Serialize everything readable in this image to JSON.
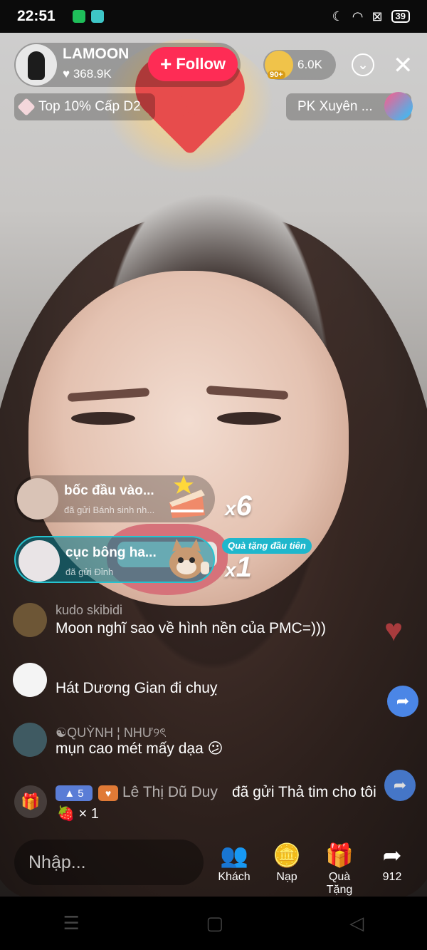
{
  "status_bar": {
    "time": "22:51",
    "battery": "39",
    "icons": [
      "moon-icon",
      "wifi-icon",
      "sim-icon",
      "battery-icon"
    ]
  },
  "host": {
    "name": "LAMOON",
    "likes": "368.9K",
    "follow_label": "Follow"
  },
  "viewers": {
    "badge": "90+",
    "count": "6.0K"
  },
  "rank": {
    "label": "Top 10% Cấp D2"
  },
  "pk": {
    "label": "PK Xuyên ..."
  },
  "gifts": [
    {
      "user": "bốc đầu vào...",
      "subtitle": "đã gửi Bánh sinh nh...",
      "combo_x": "x",
      "combo_n": "6"
    },
    {
      "user": "cục bông ha...",
      "subtitle": "đã gửi Đỉnh",
      "combo_x": "x",
      "combo_n": "1",
      "tag": "Quà tặng đầu tiên"
    }
  ],
  "comments": [
    {
      "user": "kudo skibidi",
      "text": "Moon nghĩ sao về hình nền của PMC=)))"
    },
    {
      "user": "",
      "text": "Hát Dương Gian đi chuỵ"
    },
    {
      "user": "☯QUỲNH ¦ NHƯ୨ৎ",
      "text": "mụn cao mét mấy dạa 😕"
    }
  ],
  "gift_event": {
    "level": "5",
    "user": "Lê Thị Dũ Duy",
    "text": "đã gửi Thả tim cho tôi",
    "count": "× 1"
  },
  "bottom_bar": {
    "input_placeholder": "Nhập...",
    "actions": [
      {
        "label": "Khách",
        "icon": "guests-icon"
      },
      {
        "label": "Nạp",
        "icon": "recharge-icon"
      },
      {
        "label": "Quà Tặng",
        "icon": "gift-icon"
      },
      {
        "label": "912",
        "icon": "share-icon"
      }
    ]
  },
  "colors": {
    "follow": "#fe2c55",
    "first_gift_tag": "#1fb7cc",
    "share_button": "#4b86e6"
  }
}
